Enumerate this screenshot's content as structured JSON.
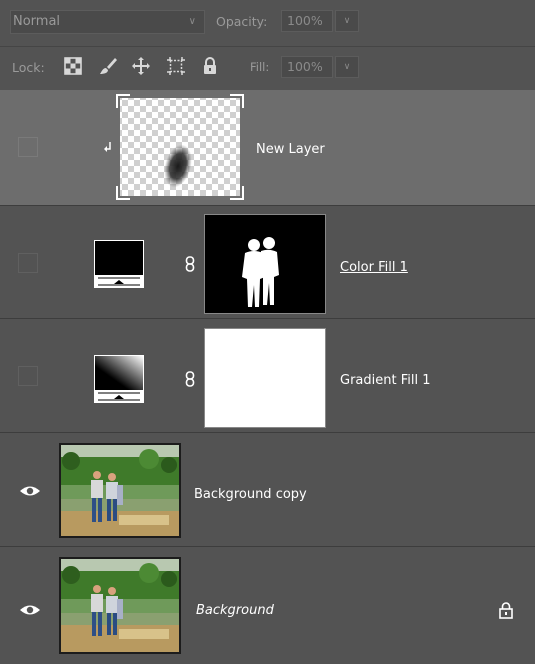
{
  "toolbar": {
    "blend_mode": "Normal",
    "opacity_label": "Opacity:",
    "opacity_value": "100%",
    "lock_label": "Lock:",
    "fill_label": "Fill:",
    "fill_value": "100%"
  },
  "layers": [
    {
      "name": "New Layer",
      "visible": false,
      "selected": true,
      "clipped": true,
      "type": "pixel"
    },
    {
      "name": "Color Fill 1",
      "visible": false,
      "selected": false,
      "type": "color-fill",
      "has_mask": true
    },
    {
      "name": "Gradient Fill 1",
      "visible": false,
      "selected": false,
      "type": "gradient-fill",
      "has_mask": true
    },
    {
      "name": "Background copy",
      "visible": true,
      "selected": false,
      "type": "photo"
    },
    {
      "name": "Background",
      "visible": true,
      "selected": false,
      "type": "photo",
      "locked": true
    }
  ],
  "colors": {
    "panel_bg": "#535353",
    "selected_bg": "#6d6d6d",
    "text": "#ffffff"
  }
}
